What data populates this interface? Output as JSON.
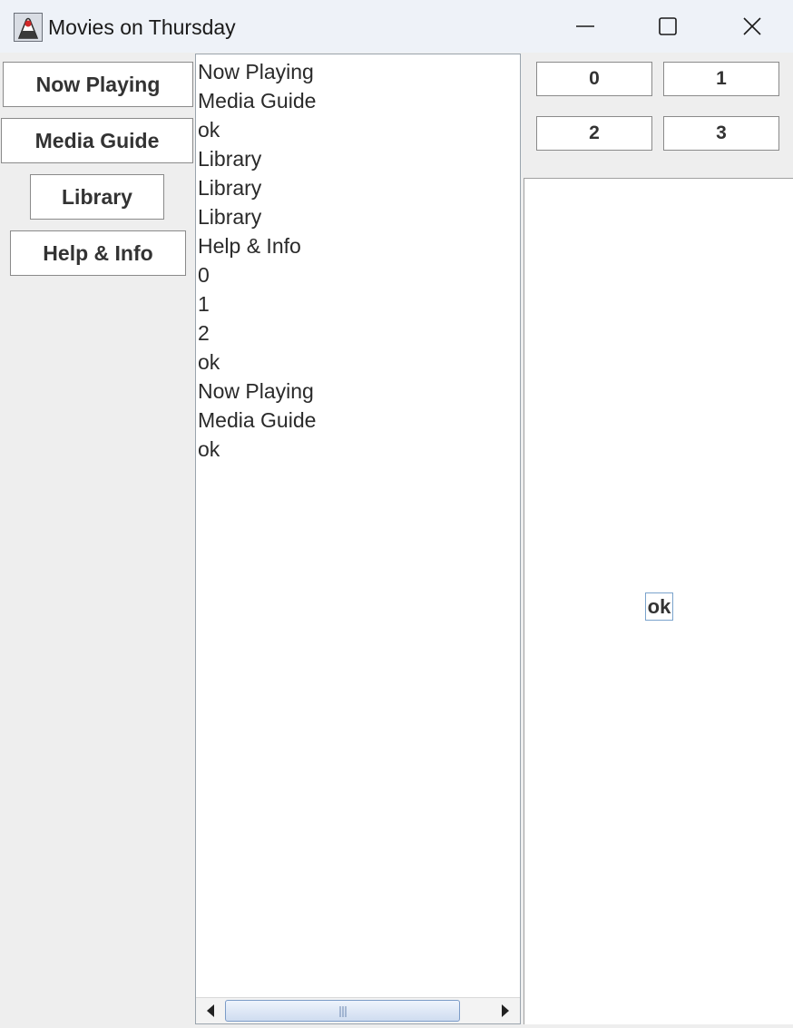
{
  "window": {
    "title": "Movies on Thursday",
    "icon": "java-duke-icon",
    "controls": [
      "minimize-icon",
      "maximize-icon",
      "close-icon"
    ]
  },
  "left_nav": {
    "buttons": [
      {
        "label": "Now Playing"
      },
      {
        "label": "Media Guide"
      },
      {
        "label": "Library"
      },
      {
        "label": "Help & Info"
      }
    ]
  },
  "list": {
    "items": [
      "Now Playing",
      "Media Guide",
      "ok",
      "Library",
      "Library",
      "Library",
      "Help & Info",
      "0",
      "1",
      "2",
      "ok",
      "Now Playing",
      "Media Guide",
      "ok"
    ]
  },
  "grid": {
    "buttons": [
      "0",
      "1",
      "2",
      "3"
    ]
  },
  "panel": {
    "ok_label": "ok"
  },
  "colors": {
    "titlebar": "#eef2f8",
    "background": "#eeeeee",
    "scroll_thumb": "#cfdcf0"
  }
}
